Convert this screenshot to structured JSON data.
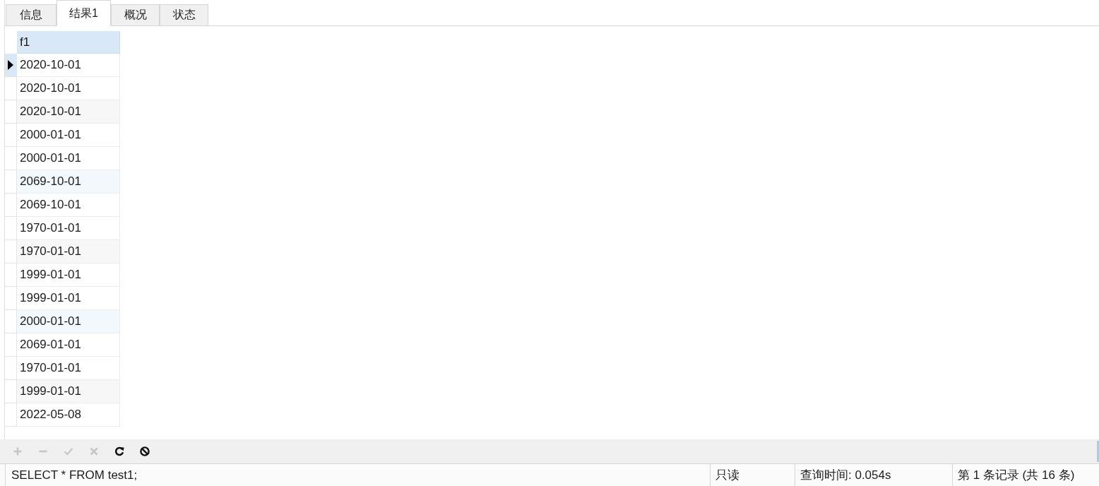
{
  "tabs": [
    {
      "label": "信息",
      "selected": false
    },
    {
      "label": "结果1",
      "selected": true
    },
    {
      "label": "概况",
      "selected": false
    },
    {
      "label": "状态",
      "selected": false
    }
  ],
  "grid": {
    "columns": [
      "f1"
    ],
    "rows": [
      {
        "cells": [
          "2020-10-01"
        ],
        "selected": true
      },
      {
        "cells": [
          "2020-10-01"
        ],
        "selected": false
      },
      {
        "cells": [
          "2020-10-01"
        ],
        "selected": false
      },
      {
        "cells": [
          "2000-01-01"
        ],
        "selected": false
      },
      {
        "cells": [
          "2000-01-01"
        ],
        "selected": false
      },
      {
        "cells": [
          "2069-10-01"
        ],
        "selected": false
      },
      {
        "cells": [
          "2069-10-01"
        ],
        "selected": false
      },
      {
        "cells": [
          "1970-01-01"
        ],
        "selected": false
      },
      {
        "cells": [
          "1970-01-01"
        ],
        "selected": false
      },
      {
        "cells": [
          "1999-01-01"
        ],
        "selected": false
      },
      {
        "cells": [
          "1999-01-01"
        ],
        "selected": false
      },
      {
        "cells": [
          "2000-01-01"
        ],
        "selected": false
      },
      {
        "cells": [
          "2069-01-01"
        ],
        "selected": false
      },
      {
        "cells": [
          "1970-01-01"
        ],
        "selected": false
      },
      {
        "cells": [
          "1999-01-01"
        ],
        "selected": false
      },
      {
        "cells": [
          "2022-05-08"
        ],
        "selected": false
      }
    ]
  },
  "toolbar": {
    "buttons": [
      {
        "kind": "add",
        "disabled": true
      },
      {
        "kind": "delete",
        "disabled": true
      },
      {
        "kind": "apply",
        "disabled": true
      },
      {
        "kind": "discard",
        "disabled": true
      },
      {
        "kind": "refresh",
        "disabled": false
      },
      {
        "kind": "stop",
        "disabled": false
      }
    ]
  },
  "status_bar": {
    "query": "SELECT * FROM test1;",
    "mode": "只读",
    "query_time": "查询时间: 0.054s",
    "record": "第 1 条记录 (共 16 条)"
  }
}
